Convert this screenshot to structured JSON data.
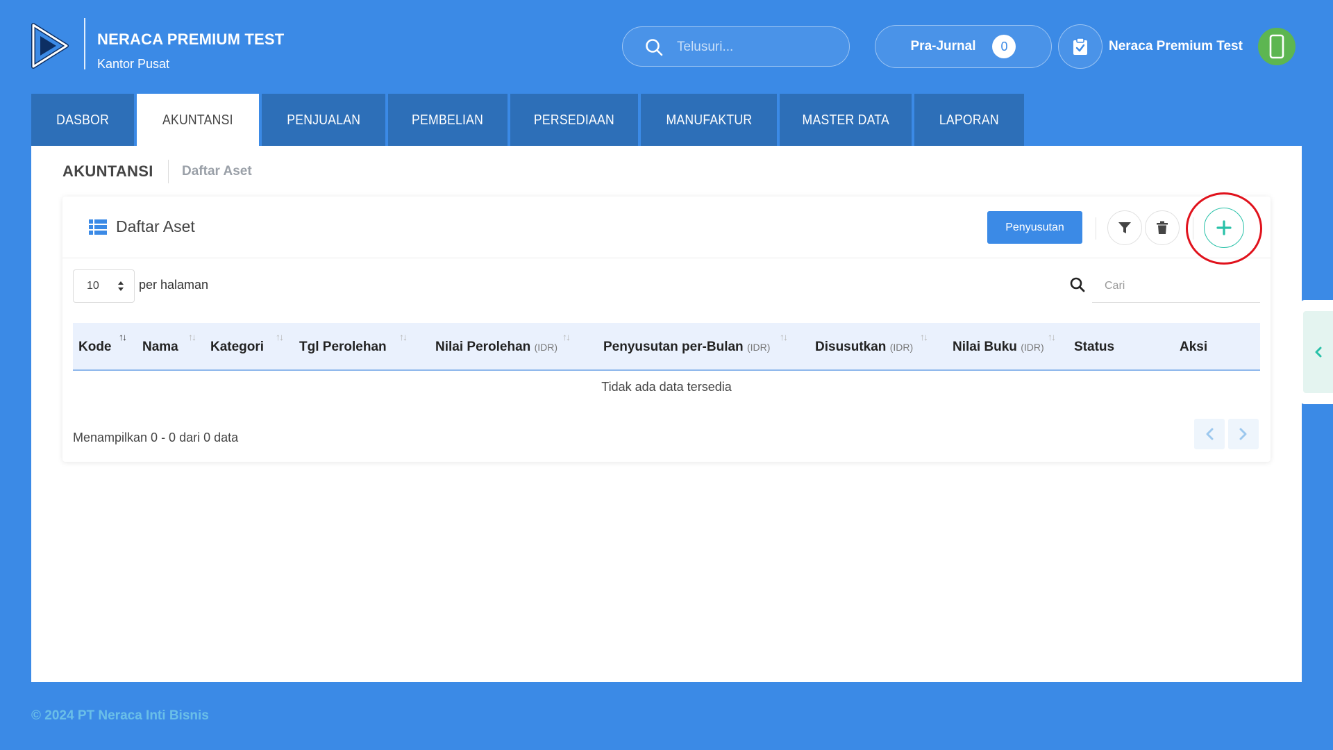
{
  "header": {
    "company_name": "NERACA PREMIUM TEST",
    "branch": "Kantor Pusat",
    "search_placeholder": "Telusuri...",
    "prajurnal_label": "Pra-Jurnal",
    "prajurnal_count": "0",
    "user_name": "Neraca Premium Test"
  },
  "tabs": [
    {
      "label": "DASBOR",
      "active": false
    },
    {
      "label": "AKUNTANSI",
      "active": true
    },
    {
      "label": "PENJUALAN",
      "active": false
    },
    {
      "label": "PEMBELIAN",
      "active": false
    },
    {
      "label": "PERSEDIAAN",
      "active": false
    },
    {
      "label": "MANUFAKTUR",
      "active": false
    },
    {
      "label": "MASTER DATA",
      "active": false
    },
    {
      "label": "LAPORAN",
      "active": false
    }
  ],
  "breadcrumb": {
    "section": "AKUNTANSI",
    "page": "Daftar Aset"
  },
  "card": {
    "title": "Daftar Aset",
    "penyusutan_label": "Penyusutan"
  },
  "table_controls": {
    "per_page_value": "10",
    "per_page_label": "per halaman",
    "search_placeholder": "Cari"
  },
  "table": {
    "columns": [
      {
        "label": "Kode",
        "unit": ""
      },
      {
        "label": "Nama",
        "unit": ""
      },
      {
        "label": "Kategori",
        "unit": ""
      },
      {
        "label": "Tgl Perolehan",
        "unit": ""
      },
      {
        "label": "Nilai Perolehan",
        "unit": "(IDR)"
      },
      {
        "label": "Penyusutan per-Bulan",
        "unit": "(IDR)"
      },
      {
        "label": "Disusutkan",
        "unit": "(IDR)"
      },
      {
        "label": "Nilai Buku",
        "unit": "(IDR)"
      },
      {
        "label": "Status",
        "unit": ""
      },
      {
        "label": "Aksi",
        "unit": ""
      }
    ],
    "empty_message": "Tidak ada data tersedia",
    "showing": "Menampilkan 0 - 0 dari 0 data"
  },
  "footer": {
    "copyright": "© 2024 PT Neraca Inti Bisnis"
  },
  "colors": {
    "background": "#3b8ae6",
    "tab_inactive": "#2d6fb8",
    "accent_teal": "#28c1a8",
    "highlight_ring": "#e0121c",
    "avatar_green": "#5db651"
  },
  "icons": {
    "logo": "neraca-logo",
    "search": "search-icon",
    "clipboard": "clipboard-check-icon",
    "avatar": "phone-icon",
    "list": "list-icon",
    "filter": "filter-icon",
    "trash": "trash-icon",
    "add": "plus-icon",
    "prev": "chevron-left-icon",
    "next": "chevron-right-icon",
    "collapse": "chevron-left-icon"
  }
}
